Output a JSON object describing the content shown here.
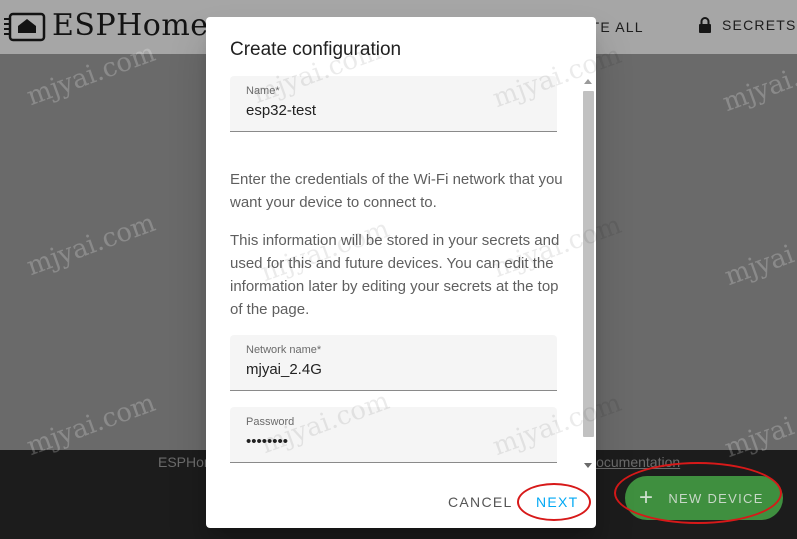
{
  "header": {
    "logo_text": "ESPHome",
    "update_all_label": "UPDATE ALL",
    "secrets_label": "SECRETS"
  },
  "footer": {
    "left_text": "ESPHome",
    "link_text": "Documentation"
  },
  "fab": {
    "icon": "plus-icon",
    "label": "NEW DEVICE",
    "color": "#3f8f3f"
  },
  "dialog": {
    "title": "Create configuration",
    "name_field": {
      "label": "Name*",
      "value": "esp32-test"
    },
    "paragraph1": "Enter the credentials of the Wi-Fi network that you want your device to connect to.",
    "paragraph2": "This information will be stored in your secrets and used for this and future devices. You can edit the information later by editing your secrets at the top of the page.",
    "network_field": {
      "label": "Network name*",
      "value": "mjyai_2.4G"
    },
    "password_field": {
      "label": "Password",
      "value": "••••••••"
    },
    "cancel_label": "CANCEL",
    "next_label": "NEXT",
    "accent_color": "#03a9f4"
  },
  "watermark": "mjyai.com"
}
